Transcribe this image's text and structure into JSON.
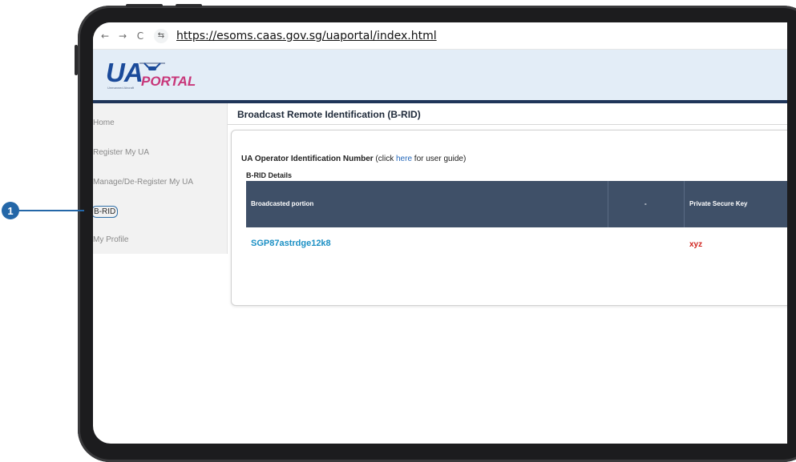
{
  "browser": {
    "back_icon": "←",
    "forward_icon": "→",
    "reload_icon": "C",
    "site_info_icon": "⇆",
    "url": "https://esoms.caas.gov.sg/uaportal/index.html"
  },
  "logo": {
    "main_text": "UA",
    "secondary_text": "PORTAL",
    "subtitle": "Unmanned Aircraft"
  },
  "sidebar": {
    "items": [
      {
        "label": "Home"
      },
      {
        "label": "Register My UA"
      },
      {
        "label": "Manage/De-Register My UA"
      },
      {
        "label": "B-RID"
      },
      {
        "label": "My Profile"
      }
    ]
  },
  "page": {
    "title": "Broadcast Remote Identification (B-RID)",
    "operator_label": "UA Operator Identification Number",
    "guide_prefix": " (click ",
    "guide_link": "here",
    "guide_suffix": " for user guide)",
    "details_label": "B-RID Details"
  },
  "table": {
    "headers": [
      "Broadcasted portion",
      "-",
      "Private Secure Key"
    ],
    "rows": [
      {
        "broadcasted": "SGP87astrdge12k8",
        "private_key": "xyz"
      }
    ]
  },
  "callout": {
    "number": "1"
  },
  "colors": {
    "accent_blue": "#2467a8",
    "table_header": "#3f5068",
    "code_blue": "#1a8fc4",
    "key_red": "#d0221c",
    "header_navy": "#1f3559"
  }
}
